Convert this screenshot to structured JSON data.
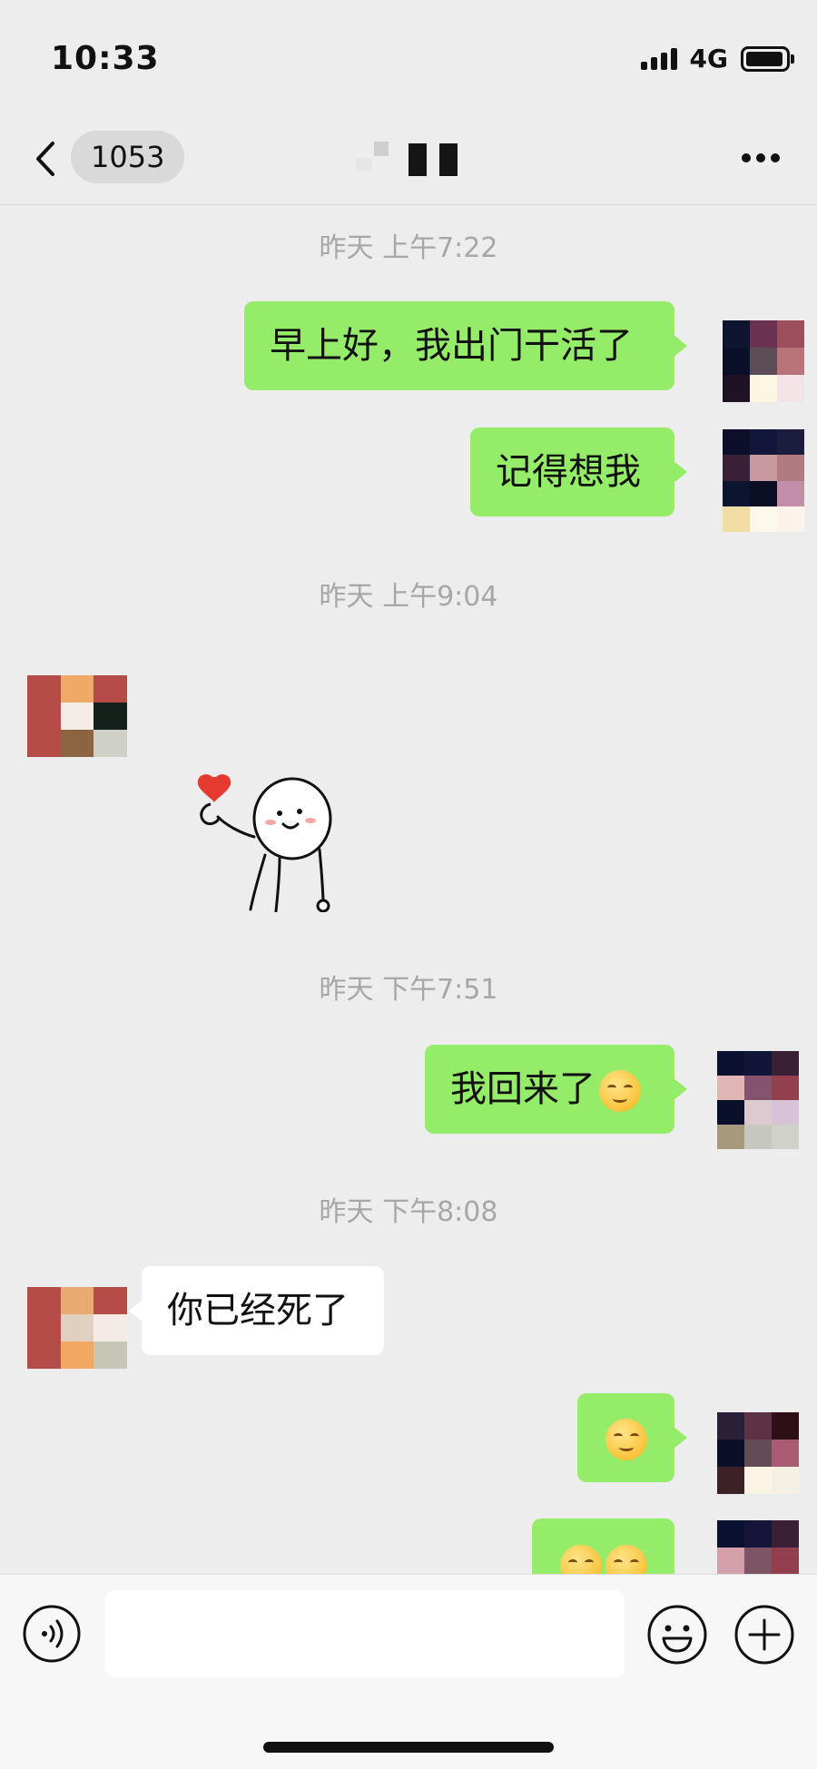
{
  "status_bar": {
    "time": "10:33",
    "network": "4G"
  },
  "nav": {
    "unread_count": "1053",
    "back_icon": "chevron-left-icon",
    "more_icon": "more-dots-icon"
  },
  "messages": [
    {
      "type": "timestamp",
      "text": "昨天 上午7:22"
    },
    {
      "type": "text",
      "from": "self",
      "text": "早上好，我出门干活了"
    },
    {
      "type": "text",
      "from": "self",
      "text": "记得想我"
    },
    {
      "type": "timestamp",
      "text": "昨天 上午9:04"
    },
    {
      "type": "sticker",
      "from": "other",
      "sticker": "finger-heart-sticker"
    },
    {
      "type": "timestamp",
      "text": "昨天 下午7:51"
    },
    {
      "type": "text",
      "from": "self",
      "text": "我回来了",
      "emoji": "smirk-emoji"
    },
    {
      "type": "timestamp",
      "text": "昨天 下午8:08"
    },
    {
      "type": "text",
      "from": "other",
      "text": "你已经死了"
    },
    {
      "type": "emoji",
      "from": "self",
      "emoji": "shush-emoji"
    },
    {
      "type": "emoji",
      "from": "self",
      "emoji": "smirk-emoji"
    }
  ],
  "input": {
    "placeholder": "",
    "value": ""
  },
  "colors": {
    "self_bubble": "#95ec69",
    "other_bubble": "#ffffff",
    "background": "#ededed"
  }
}
